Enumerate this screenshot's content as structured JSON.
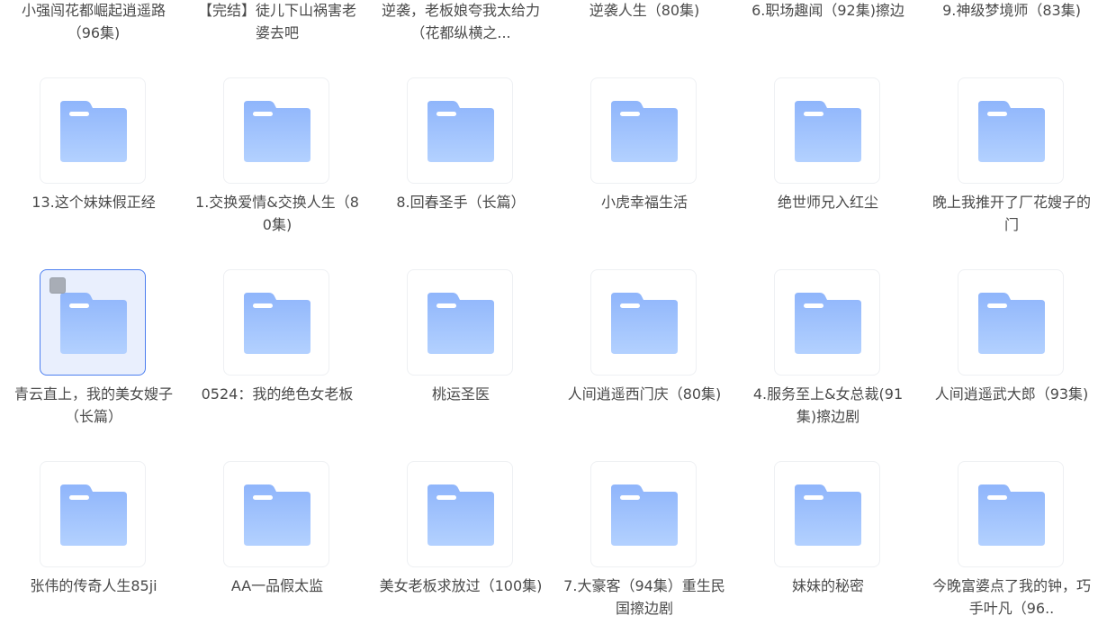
{
  "icons": {
    "folder": "folder-icon",
    "checkbox": "checkbox-icon"
  },
  "colors": {
    "folder_light": "#b3d1ff",
    "folder_dark": "#8fb5fb",
    "folder_tab": "#ffffff",
    "selection_border": "#4d7ff0",
    "selection_bg": "#e9effd"
  },
  "top_row": [
    {
      "name": "小强闯花都崛起逍遥路（96集)"
    },
    {
      "name": "【完结】徒儿下山祸害老婆去吧"
    },
    {
      "name": "逆袭，老板娘夸我太给力（花都纵横之..."
    },
    {
      "name": "逆袭人生（80集)"
    },
    {
      "name": "6.职场趣闻（92集)擦边"
    },
    {
      "name": "9.神级梦境师（83集)"
    }
  ],
  "rows": [
    [
      {
        "name": "13.这个妹妹假正经",
        "selected": false
      },
      {
        "name": "1.交换爱情&交换人生（80集)",
        "selected": false
      },
      {
        "name": "8.回春圣手（长篇）",
        "selected": false
      },
      {
        "name": "小虎幸福生活",
        "selected": false
      },
      {
        "name": "绝世师兄入红尘",
        "selected": false
      },
      {
        "name": "晚上我推开了厂花嫂子的门",
        "selected": false
      }
    ],
    [
      {
        "name": "青云直上，我的美女嫂子（长篇）",
        "selected": true
      },
      {
        "name": "0524：我的绝色女老板",
        "selected": false
      },
      {
        "name": "桃运圣医",
        "selected": false
      },
      {
        "name": "人间逍遥西门庆（80集)",
        "selected": false
      },
      {
        "name": "4.服务至上&女总裁(91集)擦边剧",
        "selected": false
      },
      {
        "name": "人间逍遥武大郎（93集)",
        "selected": false
      }
    ],
    [
      {
        "name": "张伟的传奇人生85ji",
        "selected": false
      },
      {
        "name": "AA一品假太监",
        "selected": false
      },
      {
        "name": "美女老板求放过（100集)",
        "selected": false
      },
      {
        "name": "7.大豪客（94集）重生民国擦边剧",
        "selected": false
      },
      {
        "name": "妹妹的秘密",
        "selected": false
      },
      {
        "name": "今晚富婆点了我的钟，巧手叶凡（96..",
        "selected": false
      }
    ]
  ]
}
